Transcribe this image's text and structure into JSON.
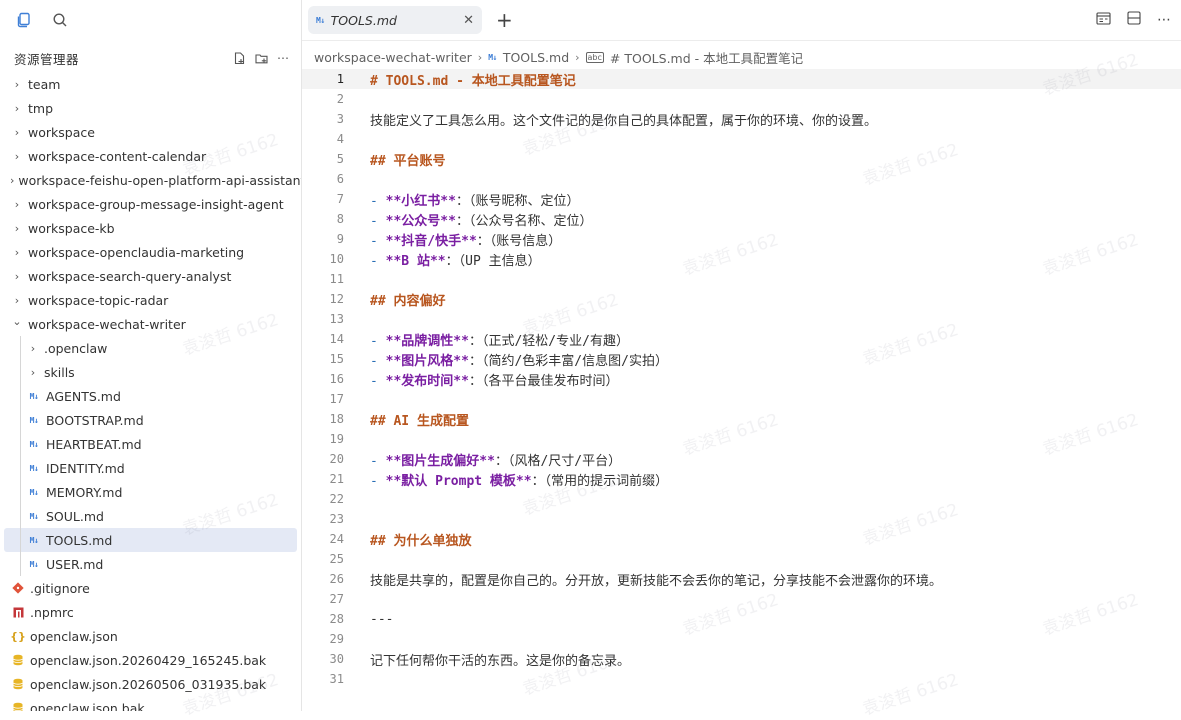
{
  "sidebar": {
    "title": "资源管理器",
    "tree": [
      {
        "label": "team",
        "type": "folder",
        "depth": 0,
        "expanded": false
      },
      {
        "label": "tmp",
        "type": "folder",
        "depth": 0,
        "expanded": false
      },
      {
        "label": "workspace",
        "type": "folder",
        "depth": 0,
        "expanded": false
      },
      {
        "label": "workspace-content-calendar",
        "type": "folder",
        "depth": 0,
        "expanded": false
      },
      {
        "label": "workspace-feishu-open-platform-api-assistant",
        "type": "folder",
        "depth": 0,
        "expanded": false
      },
      {
        "label": "workspace-group-message-insight-agent",
        "type": "folder",
        "depth": 0,
        "expanded": false
      },
      {
        "label": "workspace-kb",
        "type": "folder",
        "depth": 0,
        "expanded": false
      },
      {
        "label": "workspace-openclaudia-marketing",
        "type": "folder",
        "depth": 0,
        "expanded": false
      },
      {
        "label": "workspace-search-query-analyst",
        "type": "folder",
        "depth": 0,
        "expanded": false
      },
      {
        "label": "workspace-topic-radar",
        "type": "folder",
        "depth": 0,
        "expanded": false
      },
      {
        "label": "workspace-wechat-writer",
        "type": "folder",
        "depth": 0,
        "expanded": true
      },
      {
        "label": ".openclaw",
        "type": "folder",
        "depth": 1,
        "expanded": false
      },
      {
        "label": "skills",
        "type": "folder",
        "depth": 1,
        "expanded": false
      },
      {
        "label": "AGENTS.md",
        "type": "md",
        "depth": 1
      },
      {
        "label": "BOOTSTRAP.md",
        "type": "md",
        "depth": 1
      },
      {
        "label": "HEARTBEAT.md",
        "type": "md",
        "depth": 1
      },
      {
        "label": "IDENTITY.md",
        "type": "md",
        "depth": 1
      },
      {
        "label": "MEMORY.md",
        "type": "md",
        "depth": 1
      },
      {
        "label": "SOUL.md",
        "type": "md",
        "depth": 1
      },
      {
        "label": "TOOLS.md",
        "type": "md",
        "depth": 1,
        "selected": true
      },
      {
        "label": "USER.md",
        "type": "md",
        "depth": 1
      },
      {
        "label": ".gitignore",
        "type": "git",
        "depth": 0
      },
      {
        "label": ".npmrc",
        "type": "npm",
        "depth": 0
      },
      {
        "label": "openclaw.json",
        "type": "json",
        "depth": 0
      },
      {
        "label": "openclaw.json.20260429_165245.bak",
        "type": "bak",
        "depth": 0
      },
      {
        "label": "openclaw.json.20260506_031935.bak",
        "type": "bak",
        "depth": 0
      },
      {
        "label": "openclaw.json.bak",
        "type": "bak",
        "depth": 0
      }
    ]
  },
  "tab": {
    "label": "TOOLS.md"
  },
  "breadcrumb": {
    "folder": "workspace-wechat-writer",
    "file": "TOOLS.md",
    "symbol": "# TOOLS.md - 本地工具配置笔记"
  },
  "editor": {
    "current_line": 1,
    "lines": [
      [
        {
          "t": "# TOOLS.md - 本地工具配置笔记",
          "c": "h"
        }
      ],
      [],
      [
        {
          "t": "技能定义了工具怎么用。这个文件记的是你自己的具体配置，属于你的环境、你的设置。",
          "c": "plain"
        }
      ],
      [],
      [
        {
          "t": "## 平台账号",
          "c": "h"
        }
      ],
      [],
      [
        {
          "t": "- ",
          "c": "dash"
        },
        {
          "t": "**小红书**",
          "c": "b"
        },
        {
          "t": "：（账号昵称、定位）",
          "c": ""
        }
      ],
      [
        {
          "t": "- ",
          "c": "dash"
        },
        {
          "t": "**公众号**",
          "c": "b"
        },
        {
          "t": "：（公众号名称、定位）",
          "c": ""
        }
      ],
      [
        {
          "t": "- ",
          "c": "dash"
        },
        {
          "t": "**抖音/快手**",
          "c": "b"
        },
        {
          "t": "：（账号信息）",
          "c": ""
        }
      ],
      [
        {
          "t": "- ",
          "c": "dash"
        },
        {
          "t": "**B 站**",
          "c": "b"
        },
        {
          "t": "：（UP 主信息）",
          "c": ""
        }
      ],
      [],
      [
        {
          "t": "## 内容偏好",
          "c": "h"
        }
      ],
      [],
      [
        {
          "t": "- ",
          "c": "dash"
        },
        {
          "t": "**品牌调性**",
          "c": "b"
        },
        {
          "t": "：（正式/轻松/专业/有趣）",
          "c": ""
        }
      ],
      [
        {
          "t": "- ",
          "c": "dash"
        },
        {
          "t": "**图片风格**",
          "c": "b"
        },
        {
          "t": "：（简约/色彩丰富/信息图/实拍）",
          "c": ""
        }
      ],
      [
        {
          "t": "- ",
          "c": "dash"
        },
        {
          "t": "**发布时间**",
          "c": "b"
        },
        {
          "t": "：（各平台最佳发布时间）",
          "c": ""
        }
      ],
      [],
      [
        {
          "t": "## AI 生成配置",
          "c": "h"
        }
      ],
      [],
      [
        {
          "t": "- ",
          "c": "dash"
        },
        {
          "t": "**图片生成偏好**",
          "c": "b"
        },
        {
          "t": "：（风格/尺寸/平台）",
          "c": ""
        }
      ],
      [
        {
          "t": "- ",
          "c": "dash"
        },
        {
          "t": "**默认 Prompt 模板**",
          "c": "b"
        },
        {
          "t": "：（常用的提示词前缀）",
          "c": ""
        }
      ],
      [],
      [],
      [
        {
          "t": "## 为什么单独放",
          "c": "h"
        }
      ],
      [],
      [
        {
          "t": "技能是共享的，配置是你自己的。分开放，更新技能不会丢你的笔记，分享技能不会泄露你的环境。",
          "c": "plain"
        }
      ],
      [],
      [
        {
          "t": "---",
          "c": ""
        }
      ],
      [],
      [
        {
          "t": "记下任何帮你干活的东西。这是你的备忘录。",
          "c": "plain"
        }
      ],
      []
    ]
  },
  "watermark": {
    "text": "袁浚哲 6162"
  },
  "colors": {
    "accent": "#3f7fd6",
    "heading": "#b8561f",
    "bold": "#7a1fa2",
    "selection": "#e4e9f5"
  }
}
